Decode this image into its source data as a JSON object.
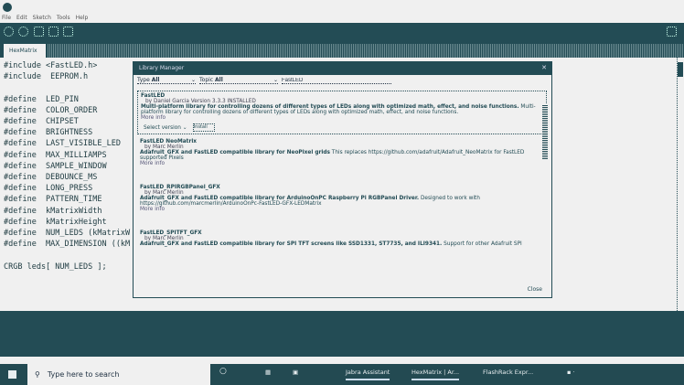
{
  "window": {
    "menu": [
      "File",
      "Edit",
      "Sketch",
      "Tools",
      "Help"
    ]
  },
  "editor": {
    "tab": "HexMatrix",
    "lines": [
      "#include <FastLED.h>",
      "#include  EEPROM.h",
      "",
      "#define  LED_PIN",
      "#define  COLOR_ORDER",
      "#define  CHIPSET",
      "#define  BRIGHTNESS",
      "#define  LAST_VISIBLE_LED",
      "#define  MAX_MILLIAMPS",
      "#define  SAMPLE_WINDOW",
      "#define  DEBOUNCE_MS",
      "#define  LONG_PRESS",
      "#define  PATTERN_TIME",
      "#define  kMatrixWidth",
      "#define  kMatrixHeight",
      "#define  NUM_LEDS (kMatrixW",
      "#define  MAX_DIMENSION ((kM",
      "",
      "CRGB leds[ NUM_LEDS ];"
    ]
  },
  "dialog": {
    "title": "Library Manager",
    "type_label": "Type",
    "type_value": "All",
    "topic_label": "Topic",
    "topic_value": "All",
    "search_value": "FastLED",
    "close": "Close",
    "entries": [
      {
        "name": "FastLED",
        "by": "by Daniel Garcia Version 3.3.3 INSTALLED",
        "summary": "Multi-platform library for controlling dozens of different types of LEDs along with optimized math, effect, and noise functions.",
        "desc": "Multi-platform library for controlling dozens of different types of LEDs along with optimized math, effect, and noise functions.",
        "more": "More info",
        "select_version": "Select version",
        "install": "Install"
      },
      {
        "name": "FastLED NeoMatrix",
        "by": "by Marc Merlin",
        "summary": "Adafruit_GFX and FastLED compatible library for NeoPixel grids",
        "desc": "This replaces https://github.com/adafruit/Adafruit_NeoMatrix for FastLED supported Pixels",
        "more": "More info"
      },
      {
        "name": "FastLED_RPIRGBPanel_GFX",
        "by": "by Marc Merlin",
        "summary": "Adafruit_GFX and FastLED compatible library for ArduinoOnPC Raspberry Pi RGBPanel Driver.",
        "desc": "Designed to work with https://github.com/marcmerlin/ArduinoOnPc-FastLED-GFX-LEDMatrix",
        "more": "More info"
      },
      {
        "name": "FastLED_SPITFT_GFX",
        "by": "by Marc Merlin",
        "summary": "Adafruit_GFX and FastLED compatible library for SPI TFT screens like SSD1331, ST7735, and ILI9341.",
        "desc": "Support for other Adafruit SPI"
      }
    ]
  },
  "taskbar": {
    "search_placeholder": "Type here to search",
    "apps": [
      "Jabra Assistant",
      "HexMatrix | Ar...",
      "FlashRack Expr..."
    ]
  }
}
